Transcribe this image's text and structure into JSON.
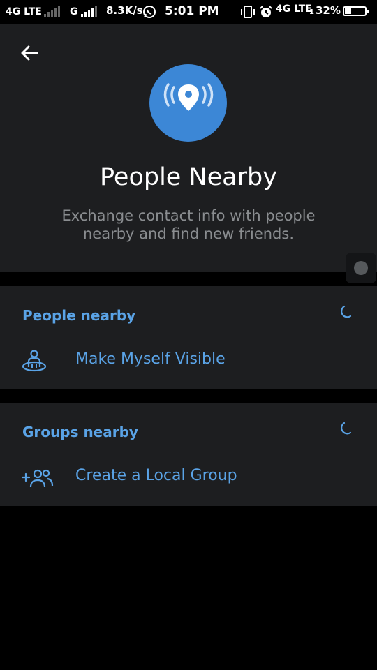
{
  "status_bar": {
    "network1": "4G LTE",
    "network2": "G",
    "speed": "8.3K/s",
    "time": "5:01 PM",
    "network3": "4G LTE",
    "sim_index": "1",
    "battery": "32%",
    "battery_level": 0.32
  },
  "header": {
    "title": "People Nearby",
    "subtitle": "Exchange contact info with people nearby and find new friends."
  },
  "sections": {
    "people": {
      "title": "People nearby",
      "action_label": "Make Myself Visible"
    },
    "groups": {
      "title": "Groups nearby",
      "action_label": "Create a Local Group"
    }
  },
  "colors": {
    "accent": "#5aa3e6",
    "logo_bg": "#3c87d6",
    "panel_bg": "#1d1e20",
    "background": "#000000",
    "subtitle": "#8a8d90"
  },
  "icons": [
    "back-arrow-icon",
    "location-broadcast-icon",
    "loading-spinner-icon",
    "visible-person-icon",
    "add-group-icon",
    "whatsapp-icon",
    "vibrate-icon",
    "alarm-icon"
  ]
}
